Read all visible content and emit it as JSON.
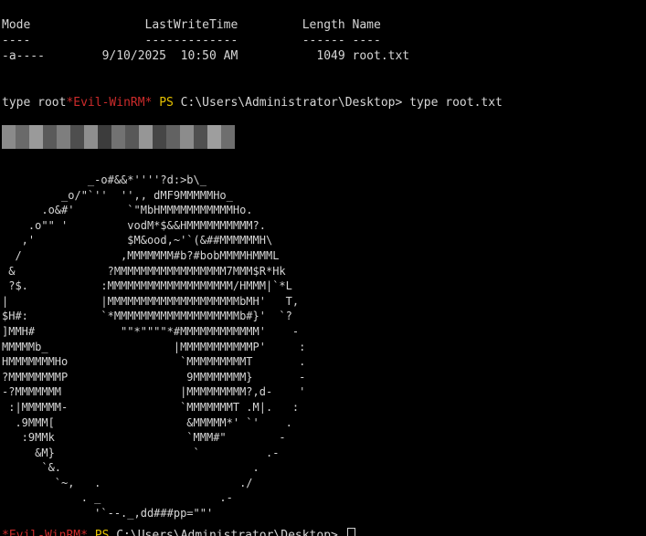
{
  "listing": {
    "header": "Mode                LastWriteTime         Length Name",
    "underline": "----                -------------         ------ ----",
    "row": "-a----        9/10/2025  10:50 AM           1049 root.txt"
  },
  "prompt1": {
    "command_prefix": "type root",
    "evil": "*Evil-WinRM*",
    "ps": "PS",
    "path_cmd": " C:\\Users\\Administrator\\Desktop> type root.txt"
  },
  "redacted_flag": {
    "colors": [
      "#8a8a8a",
      "#6a6a6a",
      "#9a9a9a",
      "#5a5a5a",
      "#7e7e7e",
      "#4e4e4e",
      "#8e8e8e",
      "#3c3c3c",
      "#727272",
      "#585858",
      "#969696",
      "#464646",
      "#626262",
      "#8c8c8c",
      "#505050",
      "#9e9e9e",
      "#6e6e6e"
    ]
  },
  "ascii_art": "             _-o#&&*''''?d:>b\\_\n         _o/\"`''  '',, dMF9MMMMMHo_\n      .o&#'        `\"MbHMMMMMMMMMMMHo.\n    .o\"\" '         vodM*$&&HMMMMMMMMMM?.\n   ,'              $M&ood,~'`(&##MMMMMMH\\\n  /               ,MMMMMMM#b?#bobMMMMHMMML\n &              ?MMMMMMMMMMMMMMMMM7MMM$R*Hk\n ?$.           :MMMMMMMMMMMMMMMMMMM/HMMM|`*L\n|              |MMMMMMMMMMMMMMMMMMMMbMH'   T,\n$H#:           `*MMMMMMMMMMMMMMMMMMMb#}'  `?\n]MMH#             \"\"*\"\"\"\"*#MMMMMMMMMMMM'    -\nMMMMMb_                   |MMMMMMMMMMMP'     :\nHMMMMMMMHo                 `MMMMMMMMMT       .\n?MMMMMMMMP                  9MMMMMMMM}       -\n-?MMMMMMM                  |MMMMMMMMM?,d-    '\n :|MMMMMM-                 `MMMMMMMT .M|.   :\n  .9MMM[                    &MMMMM*' `'    .\n   :9MMk                    `MMM#\"        -\n     &M}                     `          .-\n      `&.                             .\n        `~,   .                     ./\n            . _                  .-\n              '`--._,dd###pp=\"\"'",
  "prompt2": {
    "evil": "*Evil-WinRM*",
    "ps": "PS",
    "path": " C:\\Users\\Administrator\\Desktop> "
  }
}
